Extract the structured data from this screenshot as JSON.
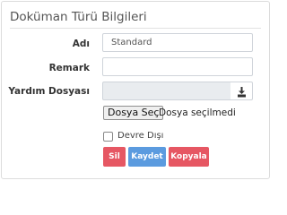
{
  "panel": {
    "title": "Doküman Türü Bilgileri"
  },
  "form": {
    "name_label": "Adı",
    "name_value": "Standard",
    "remark_label": "Remark",
    "remark_value": "",
    "help_file_label": "Yardım Dosyası",
    "help_file_value": "",
    "file_button_label": "Dosya Seç",
    "file_status": "Dosya seçilmedi",
    "inactive_label": "Devre Dışı",
    "inactive_checked": false
  },
  "actions": {
    "delete_label": "Sil",
    "save_label": "Kaydet",
    "copy_label": "Kopyala"
  },
  "colors": {
    "delete": "#e65763",
    "save": "#5b9bdf",
    "copy": "#e65763"
  },
  "icons": {
    "download": "download-icon"
  }
}
